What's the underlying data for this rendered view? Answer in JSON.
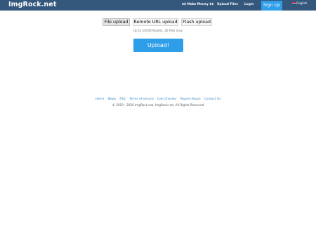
{
  "header": {
    "logo": "ImgRock.net",
    "nav": [
      {
        "label": "$$ Make Money $$"
      },
      {
        "label": "Upload Files"
      },
      {
        "label": "Login"
      }
    ],
    "signup_label": "Sign Up",
    "language": "English"
  },
  "upload": {
    "tabs": [
      {
        "label": "File upload",
        "active": true
      },
      {
        "label": "Remote URL upload",
        "active": false
      },
      {
        "label": "Flash upload",
        "active": false
      }
    ],
    "limit_note": "Up to 10240 Kbytes, 30 files max",
    "button_label": "Upload!"
  },
  "footer": {
    "links": [
      {
        "label": "Home"
      },
      {
        "label": "News"
      },
      {
        "label": "FAQ"
      },
      {
        "label": "Terms of service"
      },
      {
        "label": "Link Checker"
      },
      {
        "label": "Report Abuse"
      },
      {
        "label": "Contact Us"
      }
    ],
    "copyright": "© 2019 - 2020 ImgRock.net, ImgRock.net, All Rights Reserved"
  },
  "colors": {
    "header_bg": "#34577c",
    "accent": "#2f9ee8",
    "link": "#3d8bc9"
  }
}
